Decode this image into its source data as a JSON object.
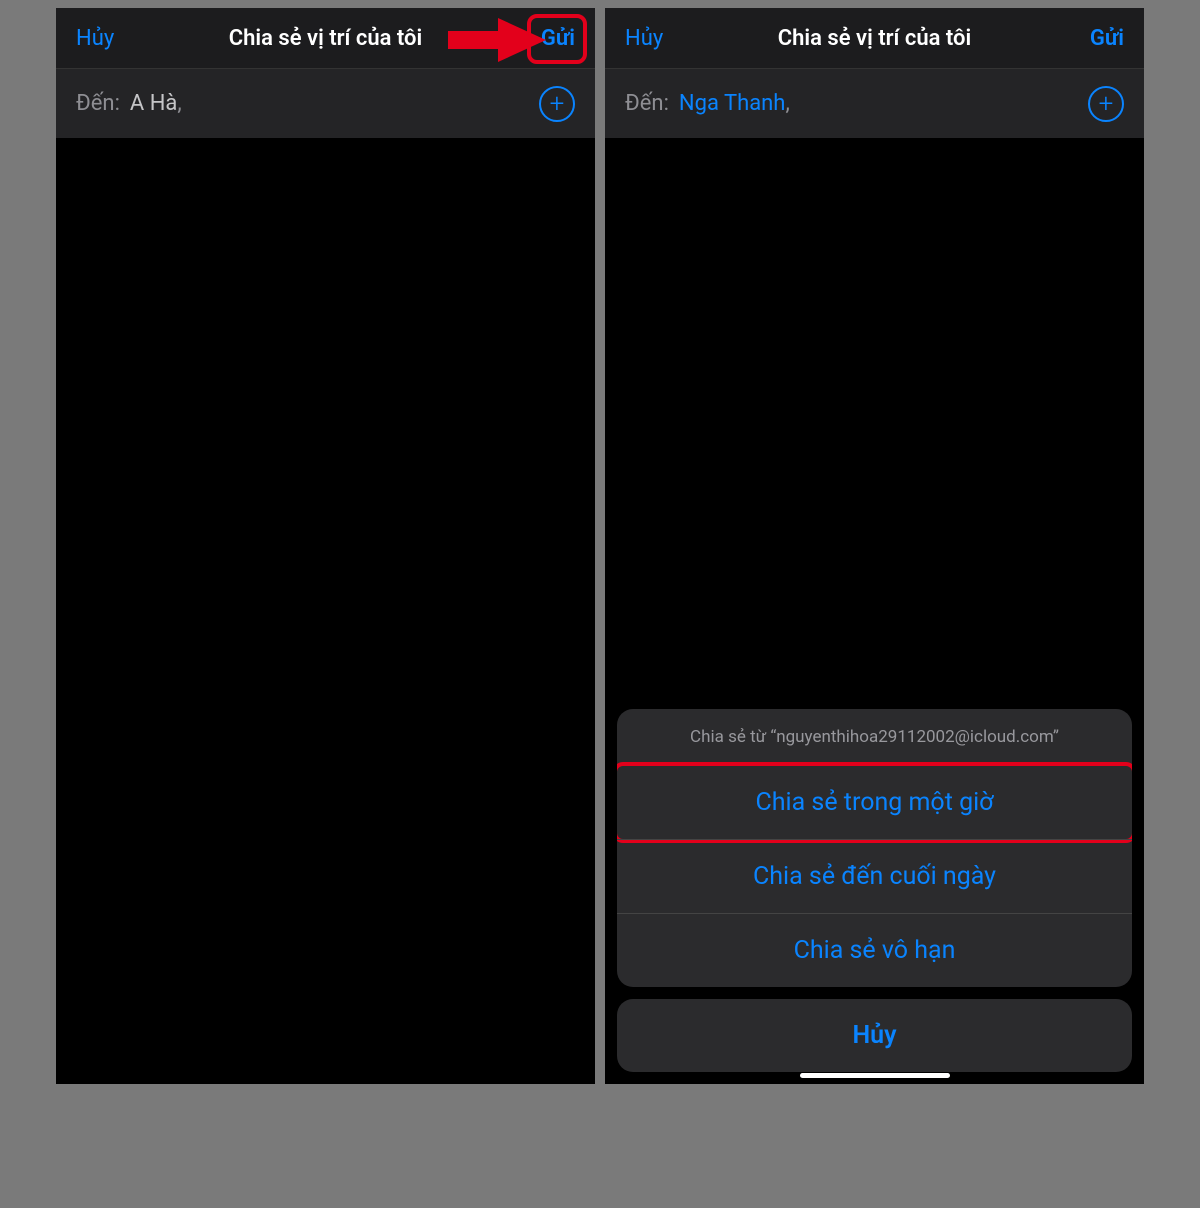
{
  "left": {
    "nav": {
      "cancel": "Hủy",
      "title": "Chia sẻ vị trí của tôi",
      "send": "Gửi"
    },
    "to": {
      "label": "Đến:",
      "value": "A Hà",
      "comma": ","
    }
  },
  "right": {
    "nav": {
      "cancel": "Hủy",
      "title": "Chia sẻ vị trí của tôi",
      "send": "Gửi"
    },
    "to": {
      "label": "Đến:",
      "value": "Nga Thanh",
      "comma": ","
    },
    "sheet": {
      "header": "Chia sẻ từ “nguyenthihoa29112002@icloud.com”",
      "opt1": "Chia sẻ trong một giờ",
      "opt2": "Chia sẻ đến cuối ngày",
      "opt3": "Chia sẻ vô hạn",
      "cancel": "Hủy"
    }
  }
}
